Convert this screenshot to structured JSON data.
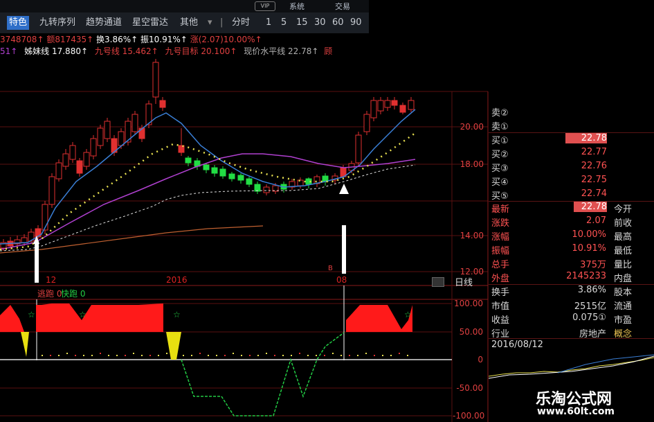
{
  "toolbar": {
    "top_links": [
      "系统",
      "交易"
    ],
    "vip_badge": "VIP",
    "tabs": [
      "特色",
      "九转序列",
      "趋势通道",
      "星空雷达",
      "其他"
    ],
    "divider": "|",
    "periods": [
      "分时",
      "1",
      "5",
      "15",
      "30",
      "60",
      "90"
    ]
  },
  "indicators": {
    "line1": [
      "3748708↑",
      "额817435↑",
      "换3.86%↑",
      "振10.91%↑",
      "涨(2.07)10.00%↑"
    ],
    "line2_prefix": "51↑",
    "line2": [
      {
        "label": "姊妹线 17.880↑",
        "color": "#ffffff"
      },
      {
        "label": "九号线 15.462↑",
        "color": "#e04040"
      },
      {
        "label": "九号目标 20.100↑",
        "color": "#e04040"
      },
      {
        "label": "现价水平线 22.78↑",
        "color": "#b0b0b0"
      },
      {
        "label": "顾",
        "color": "#e04040"
      }
    ]
  },
  "chart": {
    "y_labels": [
      "20.00",
      "18.00",
      "14.00",
      "12.00"
    ],
    "x_labels": [
      "12",
      "2016",
      "08"
    ],
    "period_button": "日线",
    "signal_marker": "B",
    "sub_legend": {
      "red": "逃跑 0",
      "green": "快跑 0"
    },
    "sub_y_labels": [
      "100.00",
      "50.00",
      "0",
      "-50.00",
      "-100.00"
    ]
  },
  "orderbook": {
    "sells": [
      {
        "label": "卖②",
        "value": ""
      },
      {
        "label": "卖①",
        "value": ""
      }
    ],
    "buys": [
      {
        "label": "买①",
        "value": "22.78"
      },
      {
        "label": "买②",
        "value": "22.77"
      },
      {
        "label": "买③",
        "value": "22.76"
      },
      {
        "label": "买④",
        "value": "22.75"
      },
      {
        "label": "买⑤",
        "value": "22.74"
      }
    ]
  },
  "stats": [
    {
      "l": "最新",
      "v": "22.78",
      "r": "今开",
      "hl": true
    },
    {
      "l": "涨跌",
      "v": "2.07",
      "r": "前收"
    },
    {
      "l": "涨幅",
      "v": "10.00%",
      "r": "最高"
    },
    {
      "l": "振幅",
      "v": "10.91%",
      "r": "最低"
    },
    {
      "l": "总手",
      "v": "375万",
      "r": "量比"
    },
    {
      "l": "外盘",
      "v": "2145233",
      "r": "内盘"
    }
  ],
  "stats2": [
    {
      "l": "换手",
      "v": "3.86%",
      "r": "股本"
    },
    {
      "l": "市值",
      "v": "2515亿",
      "r": "流通"
    },
    {
      "l": "收益",
      "v": "0.075①",
      "r": "市盈"
    },
    {
      "l": "行业",
      "v": "房地产",
      "r": "概念"
    }
  ],
  "mini_chart_date": "2016/08/12",
  "watermark": {
    "title": "乐淘公式网",
    "url": "www.60lt.com"
  },
  "colors": {
    "up": "#e03030",
    "down": "#22cc44",
    "ma_blue": "#3a7fd6",
    "ma_purple": "#b040d0",
    "ma_yellow": "#e8e050",
    "ma_orange": "#c06030"
  }
}
